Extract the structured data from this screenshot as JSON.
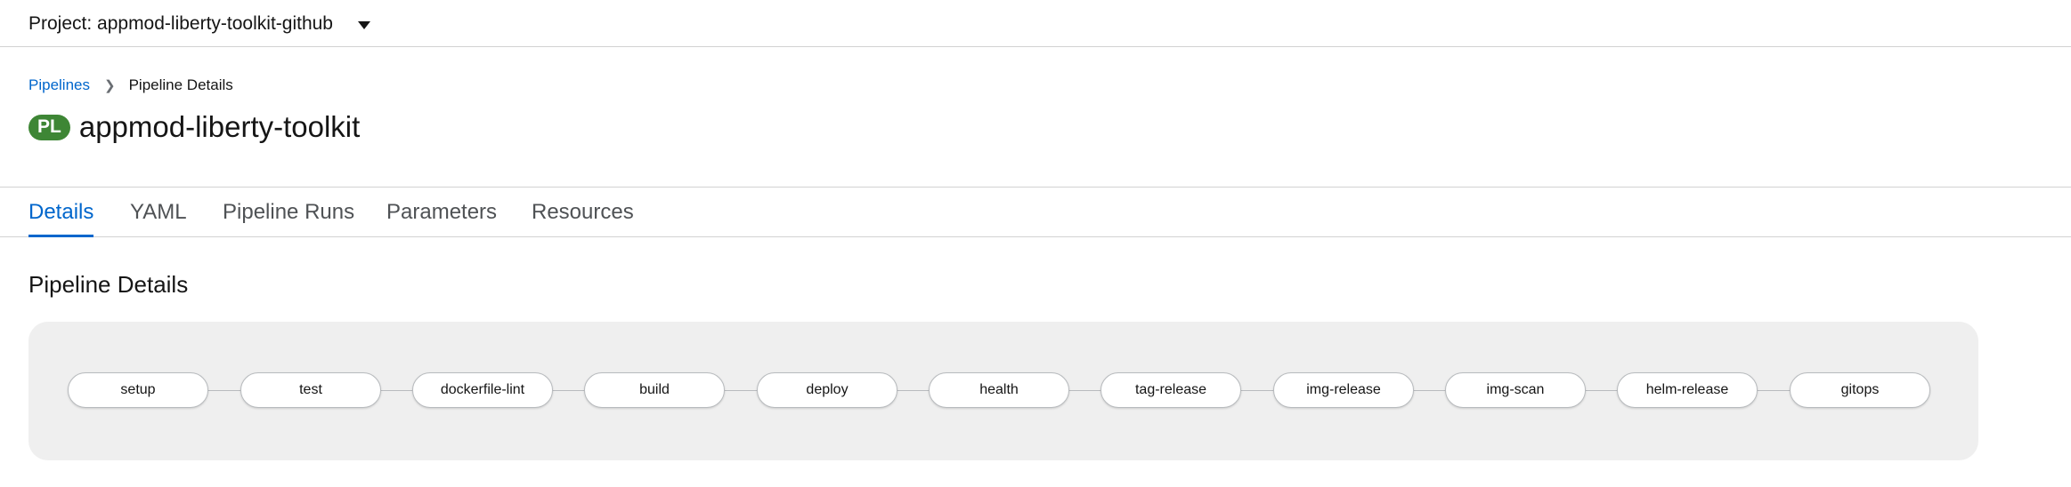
{
  "project": {
    "label": "Project: appmod-liberty-toolkit-github"
  },
  "breadcrumb": {
    "parent": "Pipelines",
    "current": "Pipeline Details"
  },
  "header": {
    "badge": "PL",
    "title": "appmod-liberty-toolkit",
    "badge_color": "#3e8635"
  },
  "tabs": [
    {
      "label": "Details",
      "active": true
    },
    {
      "label": "YAML"
    },
    {
      "label": "Pipeline Runs"
    },
    {
      "label": "Parameters"
    },
    {
      "label": "Resources"
    }
  ],
  "section": {
    "title": "Pipeline Details"
  },
  "pipeline": {
    "tasks": [
      {
        "label": "setup"
      },
      {
        "label": "test"
      },
      {
        "label": "dockerfile-lint"
      },
      {
        "label": "build"
      },
      {
        "label": "deploy"
      },
      {
        "label": "health"
      },
      {
        "label": "tag-release"
      },
      {
        "label": "img-release"
      },
      {
        "label": "img-scan"
      },
      {
        "label": "helm-release"
      },
      {
        "label": "gitops"
      }
    ]
  },
  "colors": {
    "accent": "#0066cc"
  }
}
